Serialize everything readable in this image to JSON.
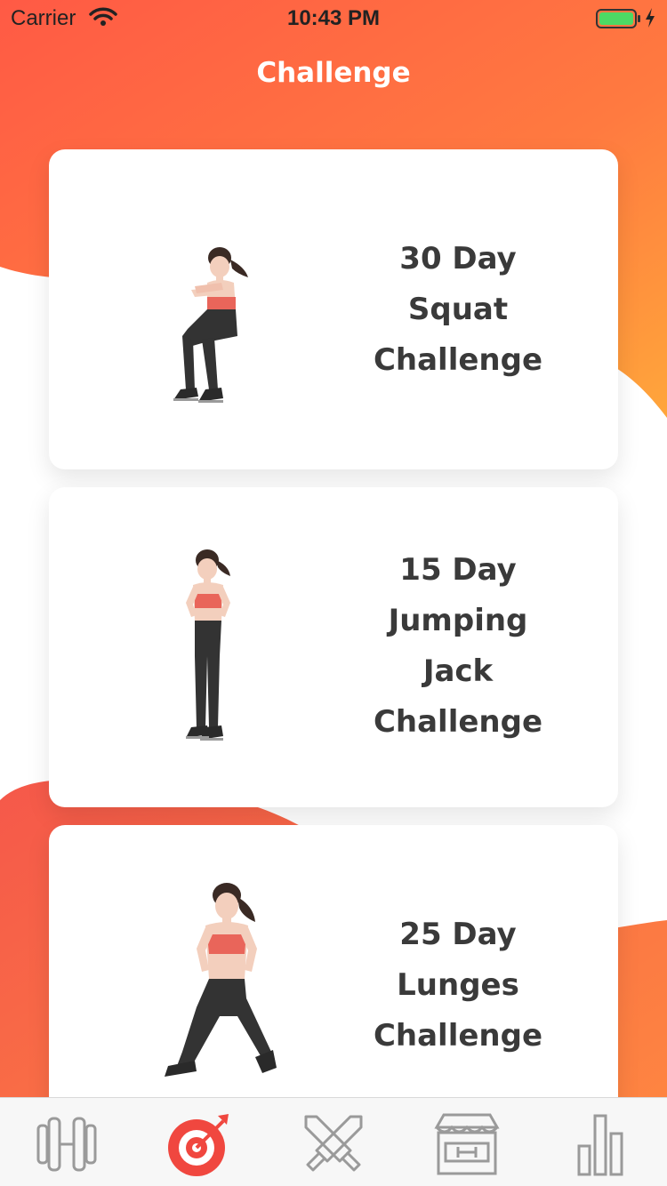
{
  "status_bar": {
    "carrier": "Carrier",
    "time": "10:43 PM",
    "wifi_icon": "wifi-icon",
    "battery_icon": "battery-icon",
    "charging_icon": "bolt-icon",
    "battery_color": "#4cd964"
  },
  "nav": {
    "title": "Challenge"
  },
  "challenges": [
    {
      "title_lines": [
        "30 Day",
        "Squat",
        "Challenge"
      ],
      "illustration": "woman-squat-illustration"
    },
    {
      "title_lines": [
        "15 Day",
        "Jumping",
        "Jack",
        "Challenge"
      ],
      "illustration": "woman-standing-illustration"
    },
    {
      "title_lines": [
        "25 Day",
        "Lunges",
        "Challenge"
      ],
      "illustration": "woman-lunge-illustration"
    }
  ],
  "tab_bar": {
    "items": [
      {
        "icon": "dumbbell-icon",
        "selected": false
      },
      {
        "icon": "target-icon",
        "selected": true
      },
      {
        "icon": "crossed-swords-icon",
        "selected": false
      },
      {
        "icon": "gym-store-icon",
        "selected": false
      },
      {
        "icon": "bar-chart-icon",
        "selected": false
      }
    ]
  },
  "colors": {
    "accent": "#f0473f",
    "header_gradient_top": "#ff5f45",
    "header_gradient_bottom": "#ff9a3e",
    "title_text": "#3a3a3a",
    "tab_icon_inactive": "#9a9a9a"
  }
}
